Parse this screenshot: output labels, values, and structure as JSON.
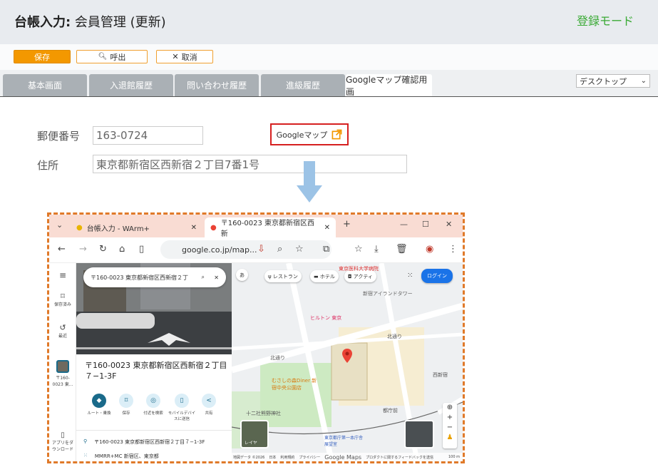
{
  "header": {
    "title_bold": "台帳入力:",
    "title_rest": " 会員管理 (更新)",
    "mode": "登録モード"
  },
  "toolbar": {
    "save_label": "保存",
    "call_label": "呼出",
    "cancel_label": "取消"
  },
  "tabs": [
    {
      "label": "基本画面"
    },
    {
      "label": "入退館履歴"
    },
    {
      "label": "問い合わせ履歴"
    },
    {
      "label": "進級履歴"
    },
    {
      "label": "Googleマップ確認用画"
    }
  ],
  "device_select": {
    "value": "デスクトップ"
  },
  "form": {
    "postal_label": "郵便番号",
    "postal_value": "163-0724",
    "address_label": "住所",
    "address_value": "東京都新宿区西新宿２丁目7番1号",
    "gmap_link": "Googleマップ"
  },
  "screenshot": {
    "tab1": "台帳入力 - WArm+",
    "tab2": "〒160-0023 東京都新宿区西新",
    "url": "google.co.jp/map...",
    "search": "〒160-0023 東京都新宿区西新宿２丁",
    "sidebar": {
      "saved": "保存済み",
      "recent": "最近",
      "place": "〒160-0023 東...",
      "app": "アプリをダウンロード"
    },
    "place_title": "〒160-0023 東京都新宿区西新宿２丁目７−1-3F",
    "actions": [
      "ルート・乗換",
      "保存",
      "付近を検索",
      "モバイルデバイスに送信",
      "共有"
    ],
    "detail1": "〒160-0023 東京都新宿区西新宿２丁目７−1-3F",
    "detail2": "MMRR+MC 新宿区、東京都",
    "map_chips": [
      "あ",
      "レストラン",
      "ホテル",
      "アクティ"
    ],
    "login": "ログイン",
    "map_labels": {
      "hospital": "東京医科大学病院",
      "tower": "新宿アイランドタワー",
      "hilton": "ヒルトン 東京",
      "kitadori1": "北通り",
      "kitadori2": "北通り",
      "nishishinjuku": "西新宿",
      "park": "むさしの森Diner 新宿中央公園店",
      "shrine": "十二社熊野神社",
      "tocho": "都庁前",
      "office": "東京都庁第一本庁舎 展望室",
      "footer1": "地図データ ©2026",
      "footer2": "日本",
      "footer3": "利用規約",
      "footer4": "プライバシー",
      "footer5": "プロダクトに関するフィードバックを送信",
      "scale": "100 m",
      "layer": "レイヤ"
    },
    "google_logo": "Google Maps"
  },
  "colors": {
    "accent_orange": "#f39800",
    "mode_green": "#3aaa35",
    "link_red": "#d62020",
    "arrow_blue": "#9cc3e6"
  }
}
